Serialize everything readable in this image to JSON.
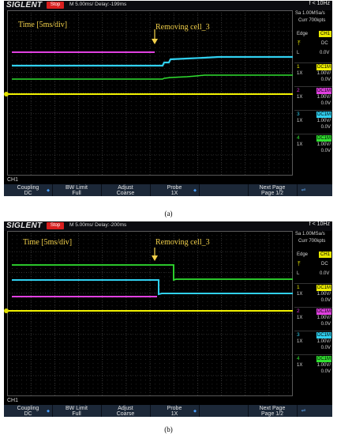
{
  "panels": [
    {
      "id": "a",
      "caption": "(a)",
      "header": {
        "logo": "SIGLENT",
        "status": "Stop",
        "timebase": "M 5.00ms/ Delay:-199ms",
        "trigger_freq": "f < 10Hz"
      },
      "sample_rate": "Sa 1.00MSa/s",
      "memory_depth": "Curr 700kpts",
      "trigger": {
        "type": "Edge",
        "source": "CH1",
        "coupling": "DC",
        "level_label": "L",
        "level": "0.0V"
      },
      "channels": [
        {
          "num": "1",
          "coupling": "DC1M",
          "probe": "1X",
          "scale": "1.00V/",
          "offset": "0.0V",
          "color": "#f0f000"
        },
        {
          "num": "2",
          "coupling": "DC1M",
          "probe": "1X",
          "scale": "1.00V/",
          "offset": "0.0V",
          "color": "#e040e0"
        },
        {
          "num": "3",
          "coupling": "DC1M",
          "probe": "1X",
          "scale": "1.00V/",
          "offset": "0.0V",
          "color": "#30d0f0"
        },
        {
          "num": "4",
          "coupling": "DC1M",
          "probe": "1X",
          "scale": "1.00V/",
          "offset": "0.0V",
          "color": "#30e030"
        }
      ],
      "annotations": {
        "time": "Time [5ms/div]",
        "event": "Removing cell_3"
      },
      "menu_title": "CH1",
      "softkeys": [
        {
          "line1": "Coupling",
          "line2": "DC"
        },
        {
          "line1": "BW Limit",
          "line2": "Full"
        },
        {
          "line1": "Adjust",
          "line2": "Coarse"
        },
        {
          "line1": "Probe",
          "line2": "1X"
        },
        {
          "line1": "",
          "line2": ""
        },
        {
          "line1": "Next Page",
          "line2": "Page 1/2"
        }
      ]
    },
    {
      "id": "b",
      "caption": "(b)",
      "header": {
        "logo": "SIGLENT",
        "status": "Stop",
        "timebase": "M 5.00ms/ Delay:-200ms",
        "trigger_freq": "f < 10Hz"
      },
      "sample_rate": "Sa 1.00MSa/s",
      "memory_depth": "Curr 700kpts",
      "trigger": {
        "type": "Edge",
        "source": "CH1",
        "coupling": "DC",
        "level_label": "L",
        "level": "0.0V"
      },
      "channels": [
        {
          "num": "1",
          "coupling": "DC1M",
          "probe": "1X",
          "scale": "1.00V/",
          "offset": "0.0V",
          "color": "#f0f000"
        },
        {
          "num": "2",
          "coupling": "DC1M",
          "probe": "1X",
          "scale": "1.00V/",
          "offset": "0.0V",
          "color": "#e040e0"
        },
        {
          "num": "3",
          "coupling": "DC1M",
          "probe": "1X",
          "scale": "1.00V/",
          "offset": "0.0V",
          "color": "#30d0f0"
        },
        {
          "num": "4",
          "coupling": "DC1M",
          "probe": "1X",
          "scale": "1.00V/",
          "offset": "0.0V",
          "color": "#30e030"
        }
      ],
      "annotations": {
        "time": "Time [5ms/div]",
        "event": "Removing cell_3"
      },
      "menu_title": "CH1",
      "softkeys": [
        {
          "line1": "Coupling",
          "line2": "DC"
        },
        {
          "line1": "BW Limit",
          "line2": "Full"
        },
        {
          "line1": "Adjust",
          "line2": "Coarse"
        },
        {
          "line1": "Probe",
          "line2": "1X"
        },
        {
          "line1": "",
          "line2": ""
        },
        {
          "line1": "Next Page",
          "line2": "Page 1/2"
        }
      ]
    }
  ],
  "colors": {
    "ch1": "#f0f000",
    "ch2": "#e040e0",
    "ch3": "#30d0f0",
    "ch4": "#30e030",
    "annotation": "#f3d14a",
    "status_stop": "#d81e1e"
  },
  "icons": {
    "usb": "usb-icon",
    "trigger_edge": "rising-edge-icon",
    "softkey_arrow": "softkey-arrow-icon"
  }
}
